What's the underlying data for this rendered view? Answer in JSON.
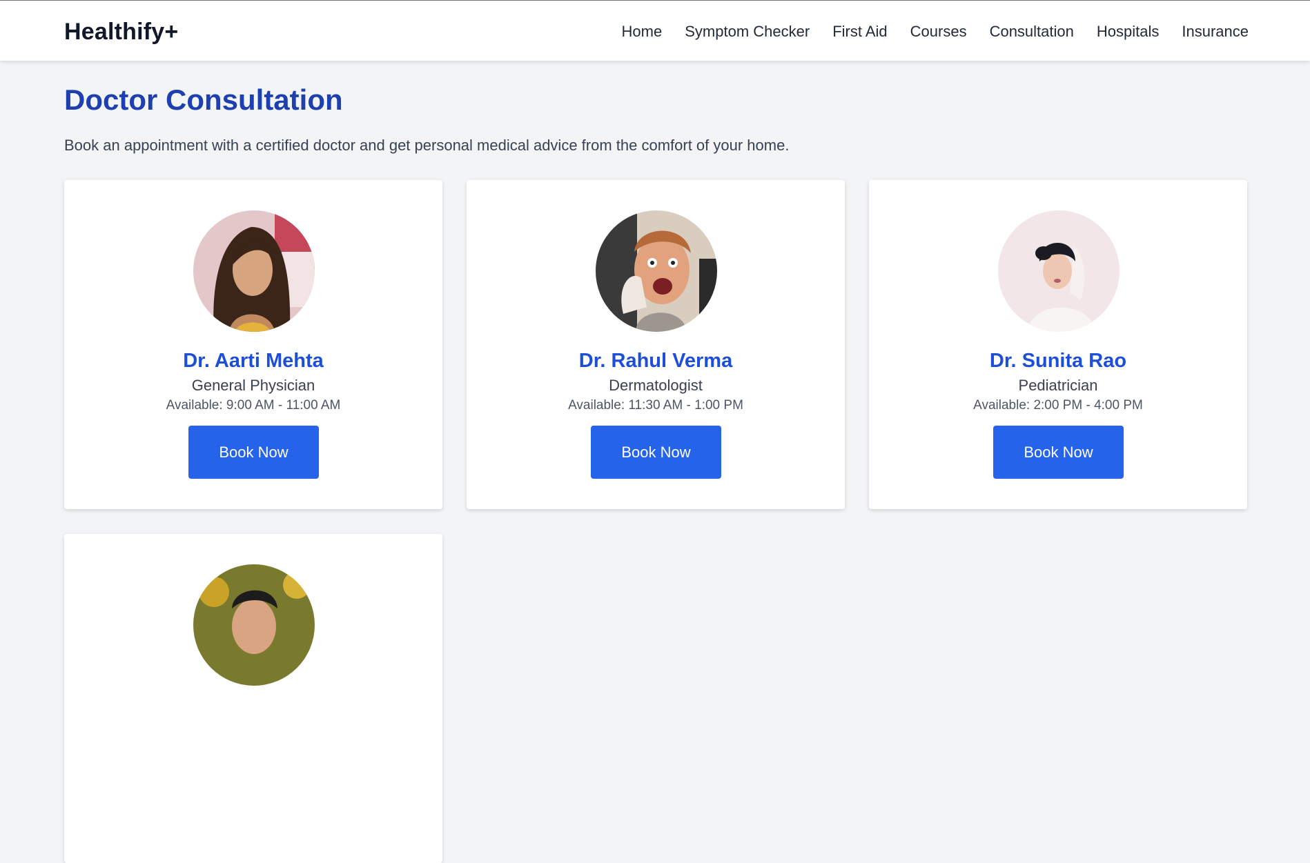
{
  "brand": "Healthify+",
  "nav": [
    "Home",
    "Symptom Checker",
    "First Aid",
    "Courses",
    "Consultation",
    "Hospitals",
    "Insurance"
  ],
  "page": {
    "title": "Doctor Consultation",
    "description": "Book an appointment with a certified doctor and get personal medical advice from the comfort of your home."
  },
  "doctors": [
    {
      "name": "Dr. Aarti Mehta",
      "specialty": "General Physician",
      "availability": "Available: 9:00 AM - 11:00 AM",
      "button": "Book Now"
    },
    {
      "name": "Dr. Rahul Verma",
      "specialty": "Dermatologist",
      "availability": "Available: 11:30 AM - 1:00 PM",
      "button": "Book Now"
    },
    {
      "name": "Dr. Sunita Rao",
      "specialty": "Pediatrician",
      "availability": "Available: 2:00 PM - 4:00 PM",
      "button": "Book Now"
    }
  ],
  "colors": {
    "accent": "#2563eb",
    "title": "#1e40af",
    "doctor_name": "#1d4ed8",
    "background": "#f3f4f6"
  }
}
